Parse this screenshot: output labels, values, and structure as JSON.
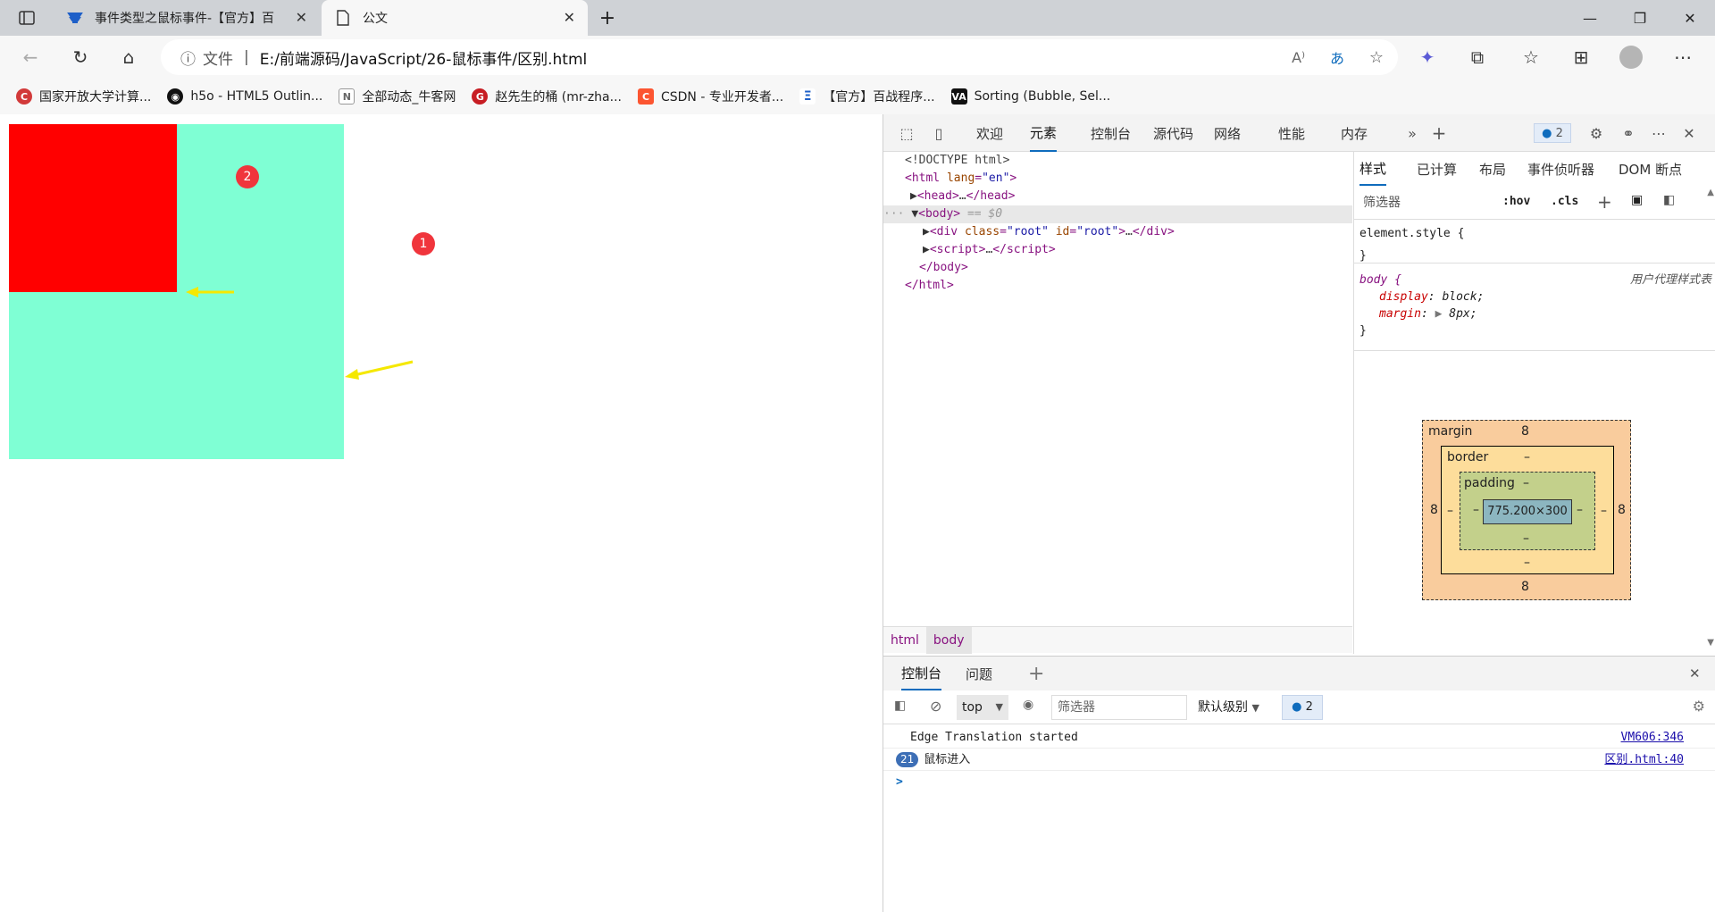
{
  "browser": {
    "tabs": [
      {
        "title": "事件类型之鼠标事件-【官方】百",
        "active": false,
        "icon": "baizhan-icon"
      },
      {
        "title": "公文",
        "active": true,
        "icon": "document-icon"
      }
    ],
    "address": {
      "label": "文件",
      "path": "E:/前端源码/JavaScript/26-鼠标事件/区别.html"
    },
    "bookmarks": [
      {
        "label": "国家开放大学计算...",
        "icon": "ouchn-icon"
      },
      {
        "label": "h5o - HTML5 Outlin...",
        "icon": "github-icon"
      },
      {
        "label": "全部动态_牛客网",
        "icon": "nowcoder-icon"
      },
      {
        "label": "赵先生的桶 (mr-zha...",
        "icon": "gitee-icon"
      },
      {
        "label": "CSDN - 专业开发者...",
        "icon": "csdn-icon"
      },
      {
        "label": "【官方】百战程序...",
        "icon": "baizhan-icon"
      },
      {
        "label": "Sorting (Bubble, Sel...",
        "icon": "visualgo-icon"
      }
    ]
  },
  "annotations": {
    "one": "1",
    "two": "2"
  },
  "devtools": {
    "tabs": [
      "欢迎",
      "元素",
      "控制台",
      "源代码",
      "网络",
      "性能",
      "内存"
    ],
    "issues_count": "2",
    "elements": {
      "doctype": "<!DOCTYPE html>",
      "html_open_tag": "html",
      "lang_attr": "lang",
      "lang_val": "\"en\"",
      "head": "head",
      "body": "body",
      "body_marker": "== $0",
      "div_attrs": {
        "class_name": "class",
        "class_val": "\"root\"",
        "id_name": "id",
        "id_val": "\"root\""
      },
      "div": "div",
      "script": "script",
      "ellipsis": "…"
    },
    "breadcrumbs": [
      "html",
      "body"
    ],
    "styles": {
      "tabs": [
        "样式",
        "已计算",
        "布局",
        "事件侦听器",
        "DOM 断点"
      ],
      "filter_placeholder": "筛选器",
      "hov": ":hov",
      "cls": ".cls",
      "element_style": "element.style {",
      "close_brace": "}",
      "body_selector": "body {",
      "user_agent": "用户代理样式表",
      "display_prop": "display",
      "display_val": "block;",
      "margin_prop": "margin",
      "margin_val": "8px;"
    },
    "box_model": {
      "margin_label": "margin",
      "margin_top": "8",
      "margin_bottom": "8",
      "margin_left": "8",
      "margin_right": "8",
      "border_label": "border",
      "border_val": "–",
      "padding_label": "padding",
      "padding_val": "–",
      "content": "775.200×300"
    },
    "console": {
      "tabs": [
        "控制台",
        "问题"
      ],
      "context": "top",
      "filter_placeholder": "筛选器",
      "level": "默认级别",
      "issues_count": "2",
      "messages": [
        {
          "text": "Edge Translation started",
          "source": "VM606:346",
          "count": ""
        },
        {
          "text": "鼠标进入",
          "source": "区别.html:40",
          "count": "21"
        }
      ],
      "prompt": ">"
    }
  }
}
